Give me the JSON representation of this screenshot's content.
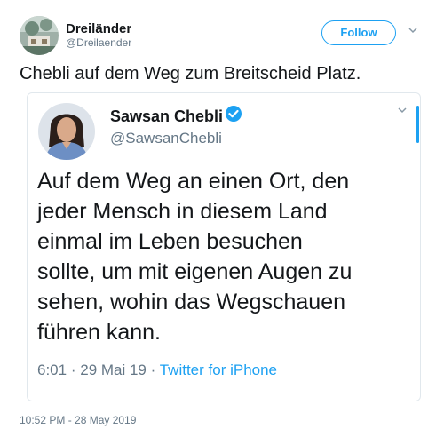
{
  "tweet": {
    "author_name": "Dreiländer",
    "author_handle": "@Dreilaender",
    "follow_label": "Follow",
    "text": "Chebli auf dem Weg zum Breitscheid Platz.",
    "timestamp": "10:52 PM - 28 May 2019"
  },
  "quoted": {
    "author_name": "Sawsan Chebli",
    "author_handle": "@SawsanChebli",
    "lines": [
      "Auf dem Weg an einen Ort, den",
      "jeder Mensch in diesem Land",
      "einmal im Leben besuchen",
      "sollte, um mit eigenen Augen zu",
      "sehen, wohin das Wegschauen",
      "führen kann."
    ],
    "time": "6:01",
    "sep1": "·",
    "date": "29 Mai 19",
    "sep2": "·",
    "source": "Twitter for iPhone"
  },
  "colors": {
    "accent": "#1da1f2",
    "secondary_text": "#657786",
    "border": "#e1e8ed"
  },
  "icons": {
    "verified": "verified-badge-icon",
    "caret": "chevron-down-icon"
  }
}
